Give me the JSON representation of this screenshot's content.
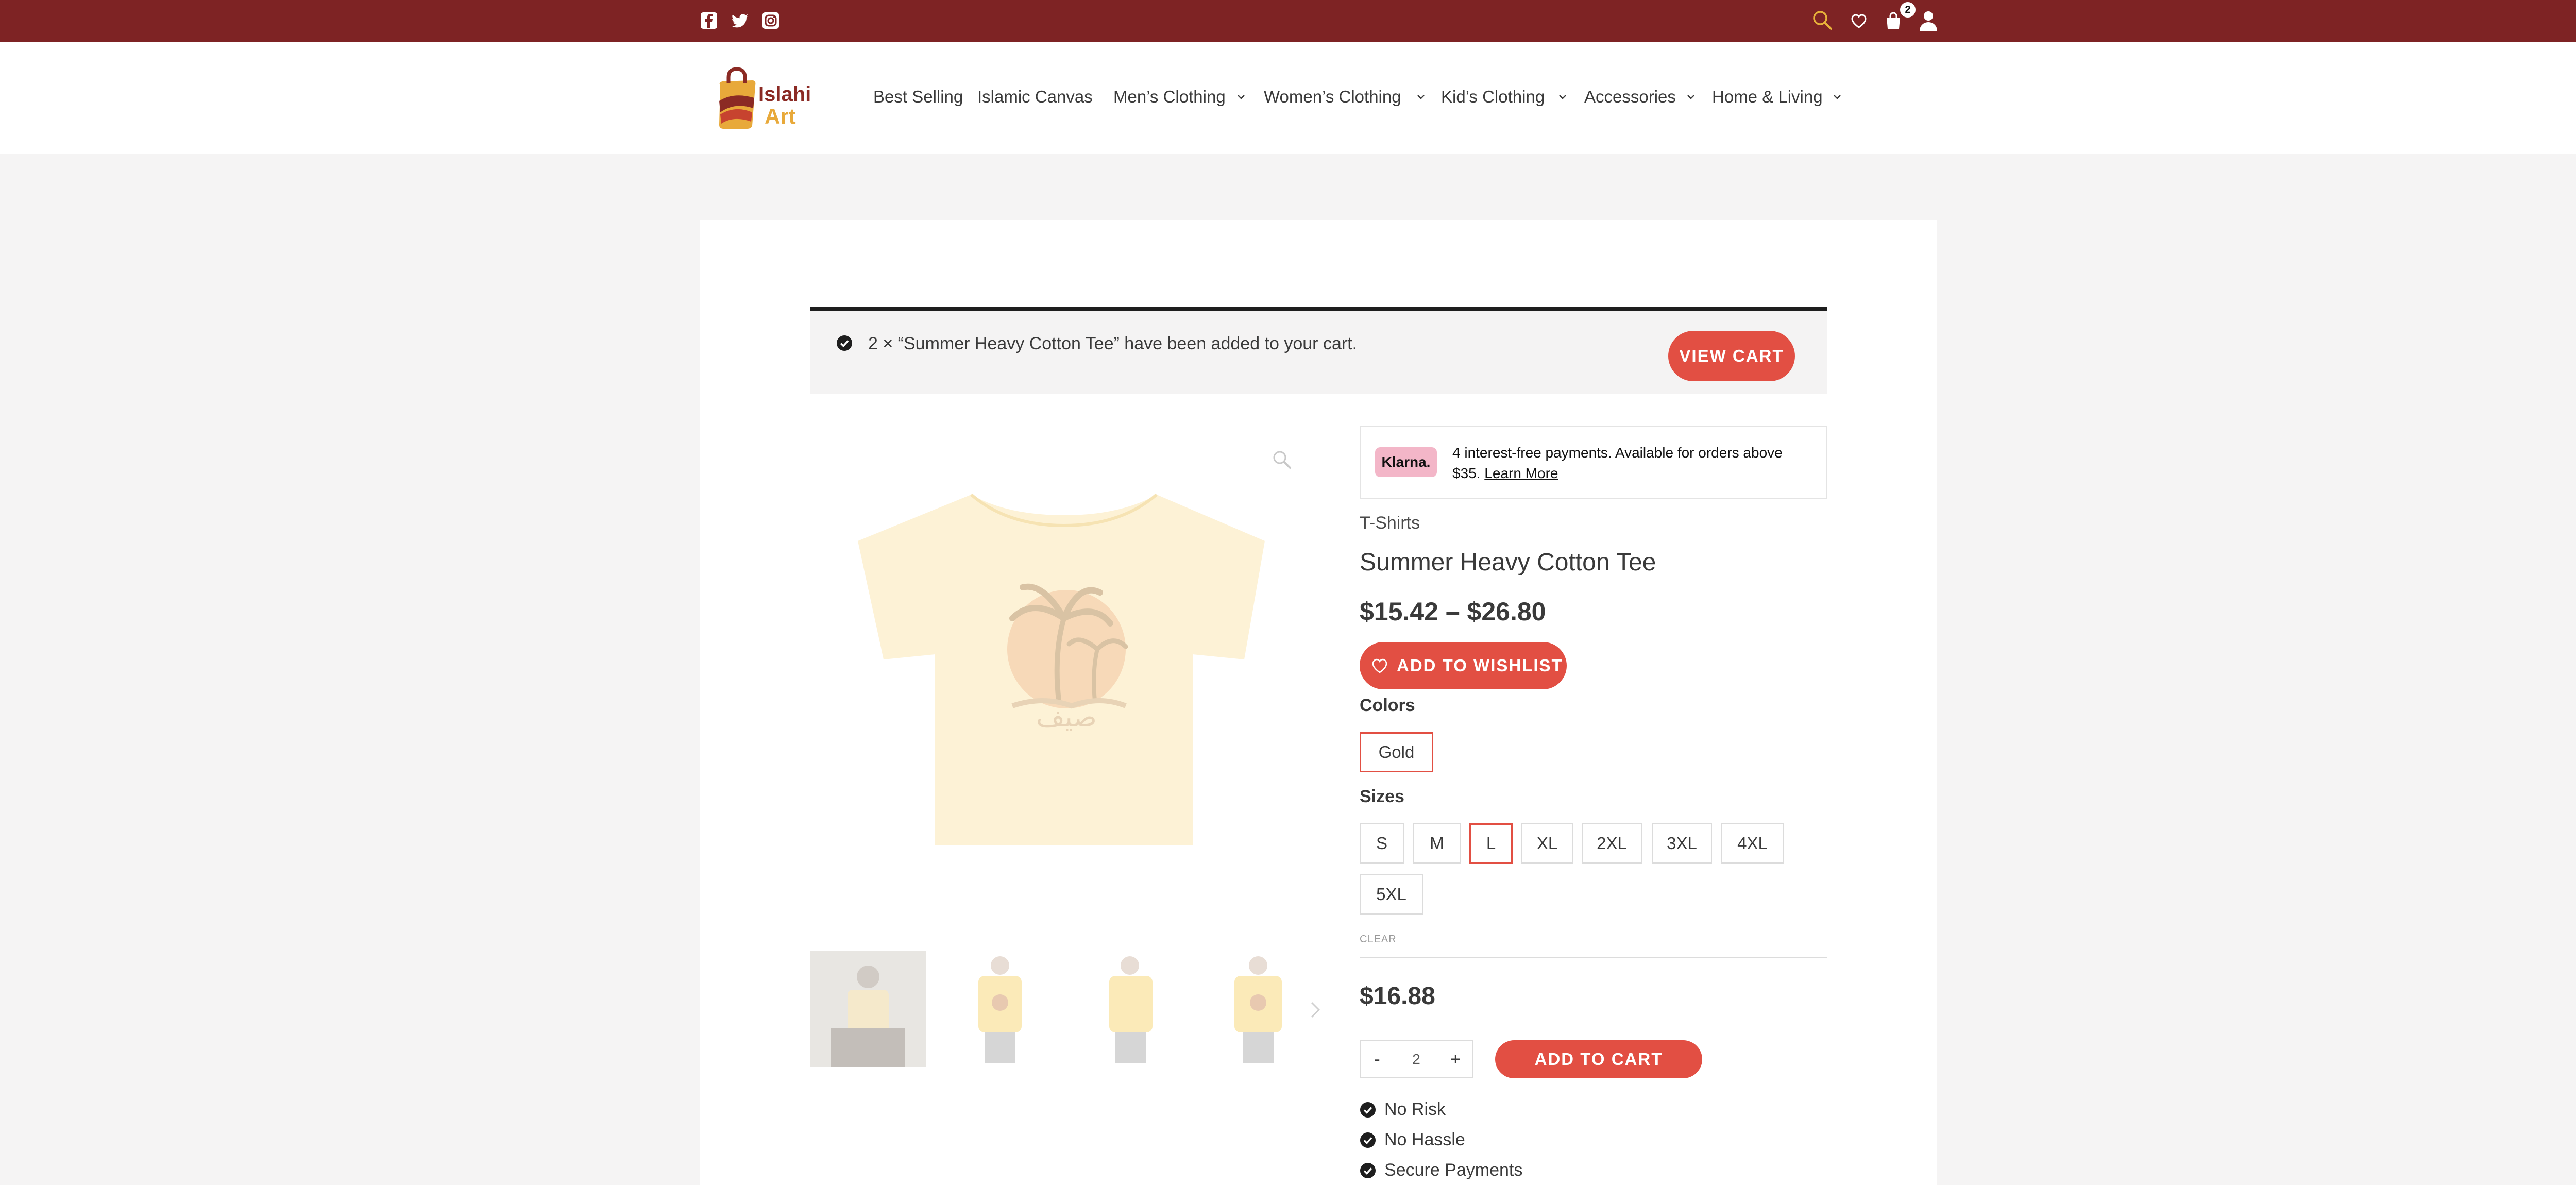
{
  "topbar": {
    "social_icons": [
      "facebook-icon",
      "twitter-icon",
      "instagram-icon"
    ],
    "cart_count": "2"
  },
  "header": {
    "logo_text_top": "Islahi",
    "logo_text_bottom": "Art",
    "nav": [
      {
        "label": "Best Selling",
        "has_dropdown": false
      },
      {
        "label": "Islamic Canvas",
        "has_dropdown": false
      },
      {
        "label": "Men’s Clothing",
        "has_dropdown": true
      },
      {
        "label": "Women’s Clothing",
        "has_dropdown": true
      },
      {
        "label": "Kid’s Clothing",
        "has_dropdown": true
      },
      {
        "label": "Accessories",
        "has_dropdown": true
      },
      {
        "label": "Home & Living",
        "has_dropdown": true
      }
    ]
  },
  "notice": {
    "message": "2 × “Summer Heavy Cotton Tee” have been added to your cart.",
    "view_cart": "VIEW CART"
  },
  "product": {
    "klarna_badge": "Klarna.",
    "klarna_text": "4 interest-free payments. Available for orders above $35.",
    "klarna_link": "Learn More",
    "category": "T-Shirts",
    "title": "Summer Heavy Cotton Tee",
    "price_range": "$15.42 – $26.80",
    "wishlist_label": "ADD TO WISHLIST",
    "colors_label": "Colors",
    "colors": [
      "Gold"
    ],
    "selected_color": "Gold",
    "sizes_label": "Sizes",
    "sizes": [
      "S",
      "M",
      "L",
      "XL",
      "2XL",
      "3XL",
      "4XL",
      "5XL"
    ],
    "selected_size": "L",
    "clear_label": "CLEAR",
    "variation_price": "$16.88",
    "qty_minus": "-",
    "qty_plus": "+",
    "quantity": "2",
    "add_to_cart": "ADD TO CART",
    "benefits": [
      "No Risk",
      "No Hassle",
      "Secure Payments"
    ]
  },
  "colors": {
    "topbar_bg": "#7e2324",
    "accent": "#e24f43",
    "shirt_gold": "#fbe7b3"
  }
}
